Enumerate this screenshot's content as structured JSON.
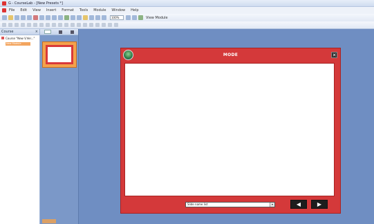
{
  "window": {
    "title": "G - CourseLab - [New Presets *]"
  },
  "menu": [
    "File",
    "Edit",
    "View",
    "Insert",
    "Format",
    "Tools",
    "Module",
    "Window",
    "Help"
  ],
  "toolbar": {
    "zoom": "100%",
    "view_module": "View Module"
  },
  "course_panel": {
    "title": "Course",
    "root": "Course \"New V.Ver...\"",
    "selected": "New Module"
  },
  "mode_window": {
    "title": "MODE",
    "close": "✕",
    "slide_select": "Slide name list",
    "prev": "◀",
    "next": "▶"
  }
}
